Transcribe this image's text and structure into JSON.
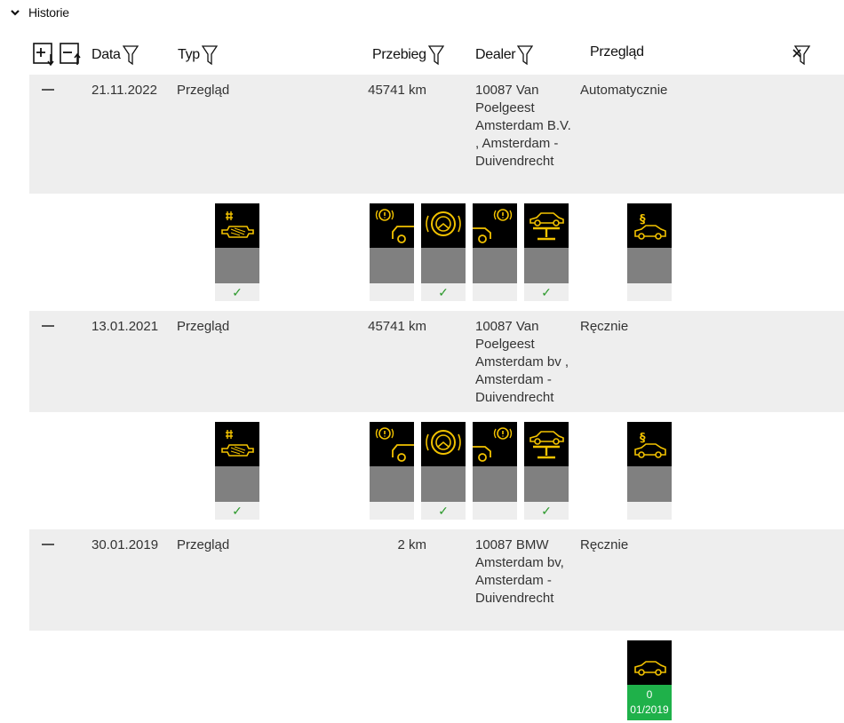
{
  "section": {
    "title": "Historie"
  },
  "columns": {
    "date": "Data",
    "type": "Typ",
    "mileage": "Przebieg",
    "dealer": "Dealer",
    "review": "Przegląd"
  },
  "entries": [
    {
      "date": "21.11.2022",
      "type": "Przegląd",
      "mileage": "45741 km",
      "dealer": "10087 Van Poelgeest Amsterdam B.V. , Amsterdam - Duivendrecht",
      "review": "Automatycznie",
      "services": [
        {
          "icon": "particle-filter-icon",
          "checked": true,
          "check": "✓"
        },
        {
          "icon": "brake-warning-car-icon",
          "checked": false,
          "check": ""
        },
        {
          "icon": "brake-pad-icon",
          "checked": true,
          "check": "✓"
        },
        {
          "icon": "rear-brake-warning-icon",
          "checked": false,
          "check": ""
        },
        {
          "icon": "car-lift-icon",
          "checked": true,
          "check": "✓"
        },
        {
          "icon": "legal-inspection-icon",
          "checked": false,
          "check": ""
        }
      ]
    },
    {
      "date": "13.01.2021",
      "type": "Przegląd",
      "mileage": "45741 km",
      "dealer": "10087 Van Poelgeest Amsterdam bv , Amsterdam - Duivendrecht",
      "review": "Ręcznie",
      "services": [
        {
          "icon": "particle-filter-icon",
          "checked": true,
          "check": "✓"
        },
        {
          "icon": "brake-warning-car-icon",
          "checked": false,
          "check": ""
        },
        {
          "icon": "brake-pad-icon",
          "checked": true,
          "check": "✓"
        },
        {
          "icon": "rear-brake-warning-icon",
          "checked": false,
          "check": ""
        },
        {
          "icon": "car-lift-icon",
          "checked": true,
          "check": "✓"
        },
        {
          "icon": "legal-inspection-icon",
          "checked": false,
          "check": ""
        }
      ]
    },
    {
      "date": "30.01.2019",
      "type": "Przegląd",
      "mileage": "2 km",
      "dealer": "10087 BMW Amsterdam bv, Amsterdam - Duivendrecht",
      "review": "Ręcznie",
      "services": [
        {
          "icon": "car-icon",
          "value": "0",
          "date": "01/2019"
        }
      ]
    }
  ],
  "colors": {
    "icon_yellow": "#f2c200",
    "check_green": "#2e9a2e",
    "status_green": "#1fb14a",
    "status_grey": "#808080",
    "row_bg": "#eeeeee"
  }
}
